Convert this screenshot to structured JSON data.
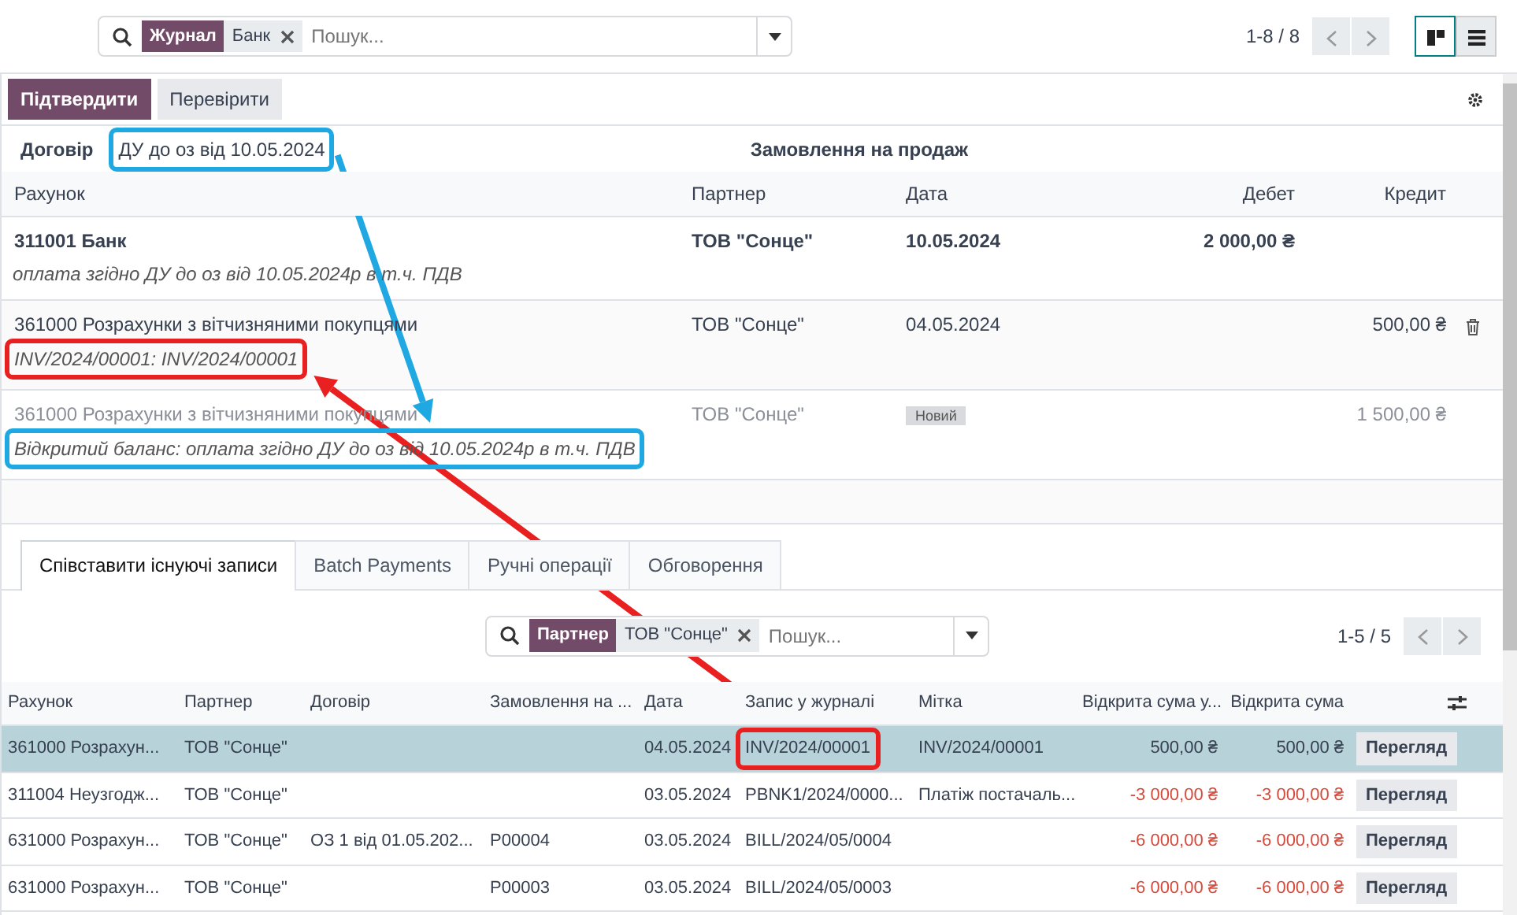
{
  "search": {
    "facets": [
      {
        "label": "Журнал",
        "value": "Банк"
      }
    ],
    "placeholder": "Пошук..."
  },
  "pager": "1-8 / 8",
  "views": [
    {
      "kind": "kanban",
      "selected": true
    },
    {
      "kind": "list",
      "selected": false
    }
  ],
  "buttons": [
    {
      "label": "Підтвердити",
      "primary": true
    },
    {
      "label": "Перевірити",
      "primary": false
    }
  ],
  "fields": {
    "contract": {
      "label": "Договір",
      "value": "ДУ до оз від 10.05.2024",
      "annotation": {
        "color": "#1fa8e1"
      }
    },
    "sale_order": {
      "label": "Замовлення на продаж"
    }
  },
  "lines_table": {
    "columns": [
      "Рахунок",
      "Партнер",
      "Дата",
      "Дебет",
      "Кредит"
    ],
    "rows": [
      {
        "kind": "statement",
        "account": "311001 Банк",
        "label": "оплата згідно ДУ до оз від 10.05.2024р в т.ч. ПДВ",
        "partner": "ТОВ \"Сонце\"",
        "date": "10.05.2024",
        "debit": "2 000,00 ₴"
      },
      {
        "kind": "matched",
        "account": "361000 Розрахунки з вітчизняними покупцями",
        "label": "INV/2024/00001: INV/2024/00001",
        "annotation": {
          "color": "#e8201f"
        },
        "partner": "ТОВ \"Сонце\"",
        "date": "04.05.2024",
        "credit": "500,00 ₴",
        "deletable": true
      },
      {
        "kind": "open_balance",
        "account": "361000 Розрахунки з вітчизняними покупцями",
        "label": "Відкритий баланс: оплата згідно ДУ до оз від 10.05.2024р в т.ч. ПДВ",
        "annotation": {
          "color": "#1fa8e1"
        },
        "partner": "ТОВ \"Сонце\"",
        "badge": "Новий",
        "credit": "1 500,00 ₴"
      }
    ]
  },
  "tabs": [
    {
      "label": "Співставити існуючі записи",
      "selected": true
    },
    {
      "label": "Batch Payments",
      "selected": false
    },
    {
      "label": "Ручні операції",
      "selected": false
    },
    {
      "label": "Обговорення",
      "selected": false
    }
  ],
  "match_search": {
    "facets": [
      {
        "label": "Партнер",
        "value": "ТОВ \"Сонце\""
      }
    ],
    "placeholder": "Пошук..."
  },
  "match_pager": "1-5 / 5",
  "candidates": {
    "columns": [
      "Рахунок",
      "Партнер",
      "Договір",
      "Замовлення на ...",
      "Дата",
      "Запис у журналі",
      "Мітка",
      "Відкрита сума у...",
      "Відкрита сума"
    ],
    "rows": [
      {
        "selected": true,
        "negative": false,
        "cells": [
          "361000 Розрахун...",
          "ТОВ \"Сонце\"",
          "",
          "",
          "04.05.2024",
          "INV/2024/00001",
          "INV/2024/00001",
          "500,00 ₴",
          "500,00 ₴"
        ],
        "annotation": {
          "color": "#e8201f"
        },
        "button": "Перегляд"
      },
      {
        "selected": false,
        "negative": true,
        "cells": [
          "311004 Неузгодж...",
          "ТОВ \"Сонце\"",
          "",
          "",
          "03.05.2024",
          "PBNK1/2024/0000...",
          "Платіж постачаль...",
          "-3 000,00 ₴",
          "-3 000,00 ₴"
        ],
        "button": "Перегляд"
      },
      {
        "selected": false,
        "negative": true,
        "cells": [
          "631000 Розрахун...",
          "ТОВ \"Сонце\"",
          "ОЗ 1 від 01.05.202...",
          "P00004",
          "03.05.2024",
          "BILL/2024/05/0004",
          "",
          "-6 000,00 ₴",
          "-6 000,00 ₴"
        ],
        "button": "Перегляд"
      },
      {
        "selected": false,
        "negative": true,
        "cells": [
          "631000 Розрахун...",
          "ТОВ \"Сонце\"",
          "",
          "P00003",
          "03.05.2024",
          "BILL/2024/05/0003",
          "",
          "-6 000,00 ₴",
          "-6 000,00 ₴"
        ],
        "button": "Перегляд"
      }
    ]
  },
  "arrows": [
    {
      "color": "#1fa8e1"
    },
    {
      "color": "#e8201f"
    }
  ]
}
